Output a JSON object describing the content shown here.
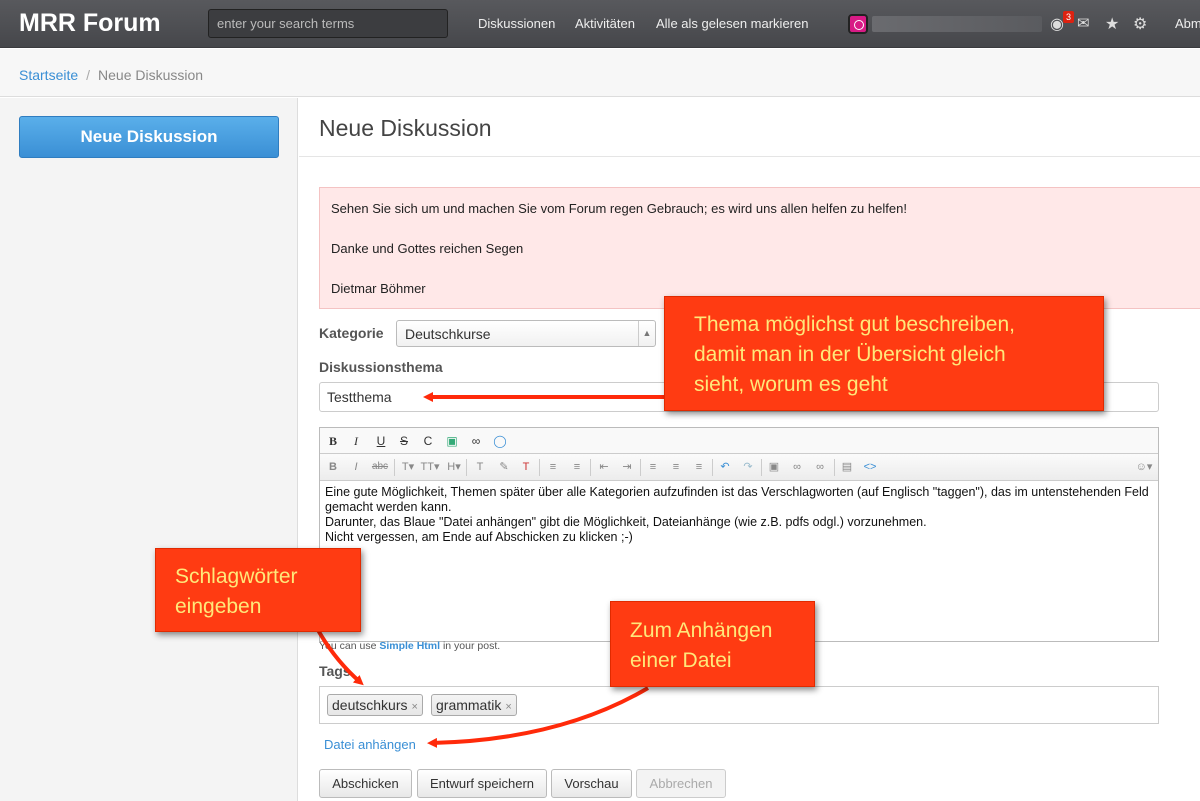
{
  "app": {
    "brand": "MRR Forum"
  },
  "header": {
    "search_placeholder": "enter your search terms",
    "nav": [
      "Diskussionen",
      "Aktivitäten",
      "Alle als gelesen markieren"
    ],
    "notification_count": "3",
    "trailing_link": "Abm"
  },
  "breadcrumb": {
    "home": "Startseite",
    "separator": "/",
    "current": "Neue Diskussion"
  },
  "sidebar": {
    "new_discussion_button": "Neue Diskussion"
  },
  "main": {
    "title": "Neue Diskussion",
    "notice": [
      "Sehen Sie sich um und machen Sie vom Forum regen Gebrauch; es wird uns allen helfen zu helfen!",
      "Danke und Gottes reichen Segen",
      "Dietmar Böhmer"
    ],
    "category_label": "Kategorie",
    "category_value": "Deutschkurse",
    "topic_label": "Diskussionsthema",
    "topic_value": "Testthema",
    "editor_lines": [
      "Eine gute Möglichkeit, Themen später über alle Kategorien aufzufinden ist das Verschlagworten (auf Englisch \"taggen\"), das im untenstehenden Feld gemacht werden kann.",
      "Darunter, das Blaue \"Datei anhängen\" gibt die Möglichkeit, Dateianhänge (wie z.B. pdfs odgl.) vorzunehmen.",
      "Nicht vergessen, am Ende auf Abschicken zu klicken ;-)"
    ],
    "hint_prefix": "You can use",
    "hint_link": "Simple Html",
    "hint_suffix": "in your post.",
    "tags_label": "Tags",
    "tags": [
      "deutschkurs",
      "grammatik"
    ],
    "tag_remove": "×",
    "attach_link": "Datei anhängen",
    "buttons": {
      "submit": "Abschicken",
      "save_draft": "Entwurf speichern",
      "preview": "Vorschau",
      "cancel": "Abbrechen"
    }
  },
  "callouts": {
    "topic": [
      "Thema möglichst gut beschreiben,",
      "damit man in der Übersicht gleich",
      "sieht, worum es geht"
    ],
    "tags": [
      "Schlagwörter",
      "eingeben"
    ],
    "attach": [
      "Zum Anhängen",
      "einer Datei"
    ]
  },
  "colors": {
    "accent": "#3a8fd5",
    "callout_bg": "#ff3b12",
    "callout_text": "#ffe87a",
    "notice_bg": "#ffe8e8"
  }
}
